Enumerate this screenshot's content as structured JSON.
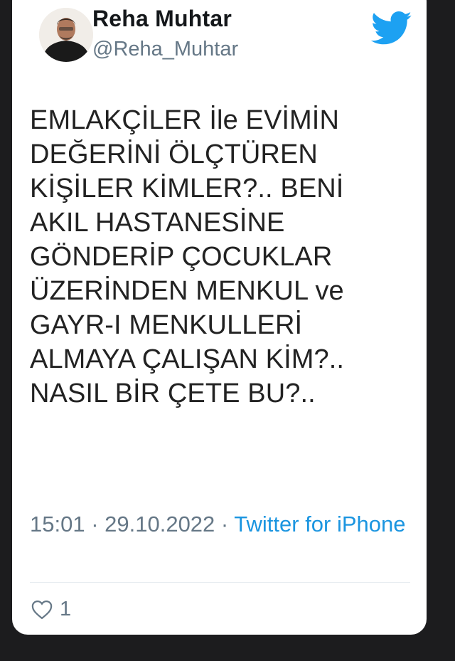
{
  "tweet": {
    "author_name": "Reha Muhtar",
    "author_handle": "@Reha_Muhtar",
    "text": "EMLAKÇİLER İle EVİMİN\nDEĞERİNİ ÖLÇTÜREN\nKİŞİLER KİMLER?.. BENİ\nAKIL HASTANESİNE\nGÖNDERİP ÇOCUKLAR\nÜZERİNDEN MENKUL ve\nGAYR-I MENKULLERİ\nALMAYA ÇALIŞAN KİM?..\nNASIL BİR ÇETE BU?..",
    "time": "15:01",
    "date": "29.10.2022",
    "separator": " · ",
    "source": "Twitter for iPhone",
    "like_count": "1"
  },
  "icons": {
    "brand": "twitter-bird-icon",
    "like": "heart-outline-icon"
  },
  "colors": {
    "background": "#1c1c1e",
    "card": "#ffffff",
    "text": "#222222",
    "secondary": "#657786",
    "twitter_blue": "#1da1f2",
    "link": "#1b95e0"
  }
}
